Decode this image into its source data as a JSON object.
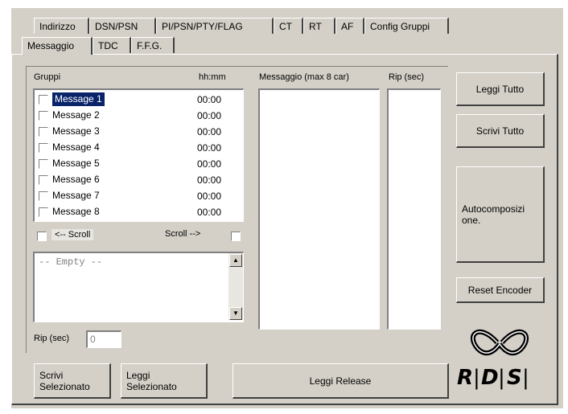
{
  "tabs_row1": [
    "Indirizzo",
    "DSN/PSN",
    "PI/PSN/PTY/FLAG",
    "CT",
    "RT",
    "AF",
    "Config Gruppi"
  ],
  "tabs_row2": [
    "Messaggio",
    "TDC",
    "F.F.G."
  ],
  "active_tab": "Messaggio",
  "groups": {
    "header_label": "Gruppi",
    "time_header": "hh:mm",
    "items": [
      {
        "name": "Message 1",
        "time": "00:00",
        "checked": false,
        "selected": true
      },
      {
        "name": "Message 2",
        "time": "00:00",
        "checked": false,
        "selected": false
      },
      {
        "name": "Message 3",
        "time": "00:00",
        "checked": false,
        "selected": false
      },
      {
        "name": "Message 4",
        "time": "00:00",
        "checked": false,
        "selected": false
      },
      {
        "name": "Message 5",
        "time": "00:00",
        "checked": false,
        "selected": false
      },
      {
        "name": "Message 6",
        "time": "00:00",
        "checked": false,
        "selected": false
      },
      {
        "name": "Message 7",
        "time": "00:00",
        "checked": false,
        "selected": false
      },
      {
        "name": "Message 8",
        "time": "00:00",
        "checked": false,
        "selected": false
      }
    ]
  },
  "scroll_left_label": "<-- Scroll",
  "scroll_right_label": "Scroll -->",
  "empty_box_text": "-- Empty --",
  "rip_label": "Rip (sec)",
  "rip_value": "0",
  "message_header": "Messaggio (max 8 car)",
  "rip_header": "Rip (sec)",
  "buttons": {
    "leggi_tutto": "Leggi Tutto",
    "scrivi_tutto": "Scrivi Tutto",
    "autocomposizione": "Autocomposizi\none.",
    "reset_encoder": "Reset Encoder",
    "scrivi_selezionato": "Scrivi\nSelezionato",
    "leggi_selezionato": "Leggi\nSelezionato",
    "leggi_release": "Leggi Release"
  },
  "logo_text": "RDS"
}
